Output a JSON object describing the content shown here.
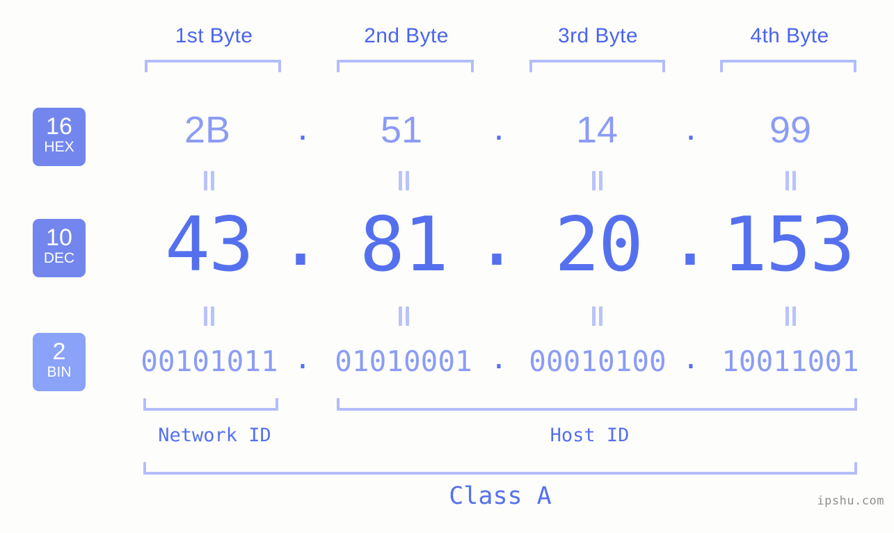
{
  "background_color": "#fdfefb",
  "colors": {
    "header_blue": "#4a64ed",
    "bracket_blue": "#b3bdfb",
    "badge_blue": "#7286ee",
    "badge_blue_light": "#8aa2f8",
    "value_light": "#8b9cf5",
    "value_strong": "#5570ee",
    "watermark_gray": "#8f8f8f"
  },
  "headers": [
    {
      "label": "1st Byte"
    },
    {
      "label": "2nd Byte"
    },
    {
      "label": "3rd Byte"
    },
    {
      "label": "4th Byte"
    }
  ],
  "bases": [
    {
      "number": "16",
      "name": "HEX"
    },
    {
      "number": "10",
      "name": "DEC"
    },
    {
      "number": "2",
      "name": "BIN"
    }
  ],
  "separator": ".",
  "equals_symbol": "||",
  "rows": {
    "hex": {
      "base": "16",
      "name": "HEX",
      "octets": [
        "2B",
        "51",
        "14",
        "99"
      ]
    },
    "dec": {
      "base": "10",
      "name": "DEC",
      "octets": [
        "43",
        "81",
        "20",
        "153"
      ]
    },
    "bin": {
      "base": "2",
      "name": "BIN",
      "octets": [
        "00101011",
        "01010001",
        "00010100",
        "10011001"
      ]
    }
  },
  "ip_address": "43.81.20.153",
  "segments": {
    "network_id_label": "Network ID",
    "host_id_label": "Host ID",
    "class_label": "Class A"
  },
  "watermark": "ipshu.com"
}
